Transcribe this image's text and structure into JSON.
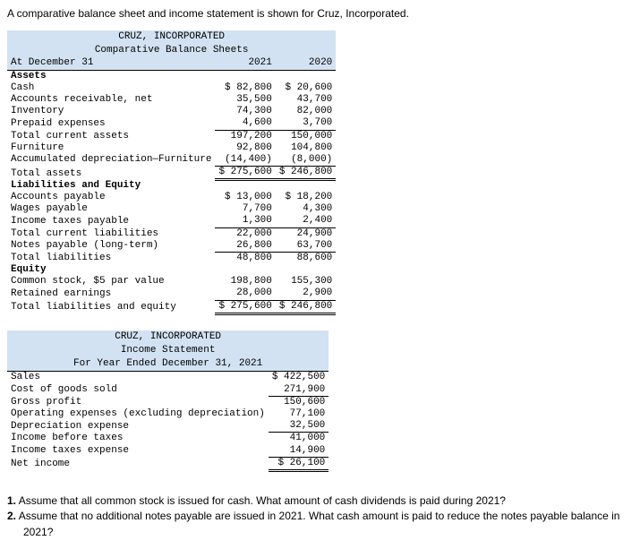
{
  "intro": "A comparative balance sheet and income statement is shown for Cruz, Incorporated.",
  "bs": {
    "company": "CRUZ, INCORPORATED",
    "title": "Comparative Balance Sheets",
    "date_label": "At December 31",
    "years": {
      "y1": "2021",
      "y2": "2020"
    },
    "s_assets": "Assets",
    "cash": {
      "l": "Cash",
      "y1": "$ 82,800",
      "y2": "$ 20,600"
    },
    "ar": {
      "l": "Accounts receivable, net",
      "y1": "35,500",
      "y2": "43,700"
    },
    "inv": {
      "l": "Inventory",
      "y1": "74,300",
      "y2": "82,000"
    },
    "ppd": {
      "l": "Prepaid expenses",
      "y1": "4,600",
      "y2": "3,700"
    },
    "tca": {
      "l": "Total current assets",
      "y1": "197,200",
      "y2": "150,000"
    },
    "furn": {
      "l": "Furniture",
      "y1": "92,800",
      "y2": "104,800"
    },
    "adep": {
      "l": "Accumulated depreciation—Furniture",
      "y1": "(14,400)",
      "y2": "(8,000)"
    },
    "ta": {
      "l": "Total assets",
      "y1": "$ 275,600",
      "y2": "$ 246,800"
    },
    "s_liab": "Liabilities and Equity",
    "ap": {
      "l": "Accounts payable",
      "y1": "$ 13,000",
      "y2": "$ 18,200"
    },
    "wp": {
      "l": "Wages payable",
      "y1": "7,700",
      "y2": "4,300"
    },
    "itp": {
      "l": "Income taxes payable",
      "y1": "1,300",
      "y2": "2,400"
    },
    "tcl": {
      "l": "Total current liabilities",
      "y1": "22,000",
      "y2": "24,900"
    },
    "np": {
      "l": "Notes payable (long-term)",
      "y1": "26,800",
      "y2": "63,700"
    },
    "tl": {
      "l": "Total liabilities",
      "y1": "48,800",
      "y2": "88,600"
    },
    "s_eq": "Equity",
    "cs": {
      "l": "Common stock, $5 par value",
      "y1": "198,800",
      "y2": "155,300"
    },
    "re": {
      "l": "Retained earnings",
      "y1": "28,000",
      "y2": "2,900"
    },
    "tle": {
      "l": "Total liabilities and equity",
      "y1": "$ 275,600",
      "y2": "$ 246,800"
    }
  },
  "is": {
    "company": "CRUZ, INCORPORATED",
    "title": "Income Statement",
    "period": "For Year Ended December 31, 2021",
    "sales": {
      "l": "Sales",
      "v": "$ 422,500"
    },
    "cogs": {
      "l": "Cost of goods sold",
      "v": "271,900"
    },
    "gp": {
      "l": "Gross profit",
      "v": "150,600"
    },
    "opex": {
      "l": "Operating expenses (excluding depreciation)",
      "v": "77,100"
    },
    "dep": {
      "l": "Depreciation expense",
      "v": "32,500"
    },
    "ibt": {
      "l": "Income before taxes",
      "v": "41,000"
    },
    "tax": {
      "l": "Income taxes expense",
      "v": "14,900"
    },
    "ni": {
      "l": "Net income",
      "v": "$ 26,100"
    }
  },
  "q": {
    "q1n": "1.",
    "q1": "Assume that all common stock is issued for cash. What amount of cash dividends is paid during 2021?",
    "q2n": "2.",
    "q2a": "Assume that no additional notes payable are issued in 2021. What cash amount is paid to reduce the notes payable balance in",
    "q2b": "2021?"
  }
}
